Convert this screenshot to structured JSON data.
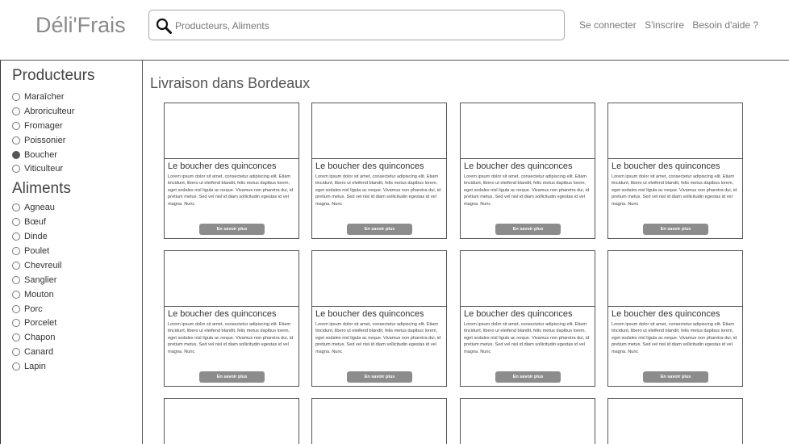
{
  "header": {
    "logo": "Déli'Frais",
    "search_placeholder": "Producteurs, Aliments",
    "login": "Se connecter",
    "signup": "S'inscrire",
    "help": "Besoin d'aide ?"
  },
  "sidebar": {
    "producers_title": "Producteurs",
    "producers": [
      {
        "label": "Maraîcher",
        "checked": false
      },
      {
        "label": "Abroriculteur",
        "checked": false
      },
      {
        "label": "Fromager",
        "checked": false
      },
      {
        "label": "Poissonier",
        "checked": false
      },
      {
        "label": "Boucher",
        "checked": true
      },
      {
        "label": "Viticulteur",
        "checked": false
      }
    ],
    "foods_title": "Aliments",
    "foods": [
      {
        "label": "Agneau",
        "checked": false
      },
      {
        "label": "Bœuf",
        "checked": false
      },
      {
        "label": "Dinde",
        "checked": false
      },
      {
        "label": "Poulet",
        "checked": false
      },
      {
        "label": "Chevreuil",
        "checked": false
      },
      {
        "label": "Sanglier",
        "checked": false
      },
      {
        "label": "Mouton",
        "checked": false
      },
      {
        "label": "Porc",
        "checked": false
      },
      {
        "label": "Porcelet",
        "checked": false
      },
      {
        "label": "Chapon",
        "checked": false
      },
      {
        "label": "Canard",
        "checked": false
      },
      {
        "label": "Lapin",
        "checked": false
      }
    ]
  },
  "main": {
    "title": "Livraison dans Bordeaux",
    "cards": [
      {
        "title": "Le boucher des quinconces",
        "text": "Lorem ipsum dolor sit amet, consectetur adipiscing elit. Etiam tincidunt, libero ut eleifend blandit, felis metus dapibus lorem, eget sodales nisl ligula ac neque. Vivamus non pharetra dui, id pretium metus. Sed vel nisl id diam sollicitudin egestas id vel magna. Nunc",
        "button": "En savoir plus"
      },
      {
        "title": "Le boucher des quinconces",
        "text": "Lorem ipsum dolor sit amet, consectetur adipiscing elit. Etiam tincidunt, libero ut eleifend blandit, felis metus dapibus lorem, eget sodales nisl ligula ac neque. Vivamus non pharetra dui, id pretium metus. Sed vel nisl id diam sollicitudin egestas id vel magna. Nunc",
        "button": "En savoir plus"
      },
      {
        "title": "Le boucher des quinconces",
        "text": "Lorem ipsum dolor sit amet, consectetur adipiscing elit. Etiam tincidunt, libero ut eleifend blandit, felis metus dapibus lorem, eget sodales nisl ligula ac neque. Vivamus non pharetra dui, id pretium metus. Sed vel nisl id diam sollicitudin egestas id vel magna. Nunc",
        "button": "En savoir plus"
      },
      {
        "title": "Le boucher des quinconces",
        "text": "Lorem ipsum dolor sit amet, consectetur adipiscing elit. Etiam tincidunt, libero ut eleifend blandit, felis metus dapibus lorem, eget sodales nisl ligula ac neque. Vivamus non pharetra dui, id pretium metus. Sed vel nisl id diam sollicitudin egestas id vel magna. Nunc",
        "button": "En savoir plus"
      },
      {
        "title": "Le boucher des quinconces",
        "text": "Lorem ipsum dolor sit amet, consectetur adipiscing elit. Etiam tincidunt, libero ut eleifend blandit, felis metus dapibus lorem, eget sodales nisl ligula ac neque. Vivamus non pharetra dui, id pretium metus. Sed vel nisl id diam sollicitudin egestas id vel magna. Nunc",
        "button": "En savoir plus"
      },
      {
        "title": "Le boucher des quinconces",
        "text": "Lorem ipsum dolor sit amet, consectetur adipiscing elit. Etiam tincidunt, libero ut eleifend blandit, felis metus dapibus lorem, eget sodales nisl ligula ac neque. Vivamus non pharetra dui, id pretium metus. Sed vel nisl id diam sollicitudin egestas id vel magna. Nunc",
        "button": "En savoir plus"
      },
      {
        "title": "Le boucher des quinconces",
        "text": "Lorem ipsum dolor sit amet, consectetur adipiscing elit. Etiam tincidunt, libero ut eleifend blandit, felis metus dapibus lorem, eget sodales nisl ligula ac neque. Vivamus non pharetra dui, id pretium metus. Sed vel nisl id diam sollicitudin egestas id vel magna. Nunc",
        "button": "En savoir plus"
      },
      {
        "title": "Le boucher des quinconces",
        "text": "Lorem ipsum dolor sit amet, consectetur adipiscing elit. Etiam tincidunt, libero ut eleifend blandit, felis metus dapibus lorem, eget sodales nisl ligula ac neque. Vivamus non pharetra dui, id pretium metus. Sed vel nisl id diam sollicitudin egestas id vel magna. Nunc",
        "button": "En savoir plus"
      }
    ]
  }
}
